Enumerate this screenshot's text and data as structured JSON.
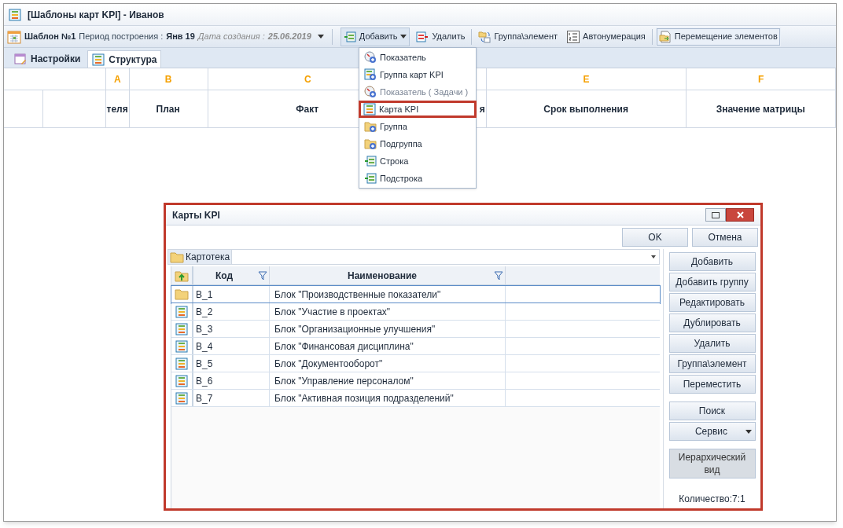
{
  "window": {
    "title": "[Шаблоны карт KPI] - Иванов"
  },
  "toolbar": {
    "template": "Шаблон №1",
    "period_label": "Период построения :",
    "period": "Янв 19",
    "created_label": "Дата создания :",
    "created": "25.06.2019",
    "buttons": [
      {
        "label": "Добавить",
        "kind": "add",
        "open": true,
        "checked": false
      },
      {
        "label": "Удалить",
        "kind": "delete",
        "open": false,
        "checked": false
      },
      {
        "label": "Группа\\элемент",
        "kind": "group",
        "open": false,
        "checked": false
      },
      {
        "label": "Автонумерация",
        "kind": "numbering",
        "open": false,
        "checked": false
      },
      {
        "label": "Перемещение элементов",
        "kind": "move",
        "open": false,
        "checked": true
      }
    ]
  },
  "tabs": [
    {
      "label": "Настройки",
      "kind": "settings",
      "selected": false
    },
    {
      "label": "Структура",
      "kind": "structure",
      "selected": true
    }
  ],
  "grid": {
    "columns": [
      {
        "letter": "A",
        "name": "теля"
      },
      {
        "letter": "B",
        "name": "План"
      },
      {
        "letter": "C",
        "name": "Факт"
      },
      {
        "name": "я"
      },
      {
        "letter": "E",
        "name": "Срок выполнения"
      },
      {
        "letter": "F",
        "name": "Значение матрицы"
      }
    ]
  },
  "menu": {
    "items": [
      {
        "label": "Показатель",
        "kind": "indicator",
        "disabled": false,
        "highlighted": false
      },
      {
        "label": "Группа карт KPI",
        "kind": "card-group",
        "disabled": false,
        "highlighted": false
      },
      {
        "label": "Показатель ( Задачи )",
        "kind": "task",
        "disabled": true,
        "highlighted": false
      },
      {
        "label": "Карта KPI",
        "kind": "card",
        "disabled": false,
        "highlighted": true
      },
      {
        "label": "Группа",
        "kind": "folder",
        "disabled": false,
        "highlighted": false
      },
      {
        "label": "Подгруппа",
        "kind": "folder",
        "disabled": false,
        "highlighted": false
      },
      {
        "label": "Строка",
        "kind": "row",
        "disabled": false,
        "highlighted": false
      },
      {
        "label": "Подстрока",
        "kind": "row",
        "disabled": false,
        "highlighted": false
      }
    ]
  },
  "dialog": {
    "title": "Карты KPI",
    "top_buttons": [
      "OK",
      "Отмена"
    ],
    "folder_tab": "Картотека",
    "columns": [
      "Код",
      "Наименование"
    ],
    "rows": [
      {
        "kind": "folder",
        "code": "B_1",
        "name": "Блок \"Производственные показатели\"",
        "selected": true
      },
      {
        "kind": "card",
        "code": "B_2",
        "name": "Блок \"Участие в проектах\"",
        "selected": false
      },
      {
        "kind": "card",
        "code": "B_3",
        "name": "Блок \"Организационные улучшения\"",
        "selected": false
      },
      {
        "kind": "card",
        "code": "B_4",
        "name": "Блок \"Финансовая дисциплина\"",
        "selected": false
      },
      {
        "kind": "card",
        "code": "B_5",
        "name": "Блок \"Документооборот\"",
        "selected": false
      },
      {
        "kind": "card",
        "code": "B_6",
        "name": "Блок \"Управление персоналом\"",
        "selected": false
      },
      {
        "kind": "card",
        "code": "B_7",
        "name": "Блок \"Активная позиция подразделений\"",
        "selected": false
      }
    ],
    "side_buttons": [
      {
        "label": "Добавить",
        "kind": "button",
        "pressed": false
      },
      {
        "label": "Добавить группу",
        "kind": "button",
        "pressed": false
      },
      {
        "label": "Редактировать",
        "kind": "button",
        "pressed": false
      },
      {
        "label": "Дублировать",
        "kind": "button",
        "pressed": false
      },
      {
        "label": "Удалить",
        "kind": "button",
        "pressed": false
      },
      {
        "label": "Группа\\элемент",
        "kind": "button",
        "pressed": false
      },
      {
        "label": "Переместить",
        "kind": "button",
        "pressed": false
      },
      {
        "label": "Поиск",
        "kind": "gap-button",
        "pressed": false
      },
      {
        "label": "Сервис",
        "kind": "dropdown",
        "pressed": false
      },
      {
        "label": "Иерархический вид",
        "kind": "toggle",
        "pressed": true
      }
    ],
    "count": "Количество:7:1"
  }
}
